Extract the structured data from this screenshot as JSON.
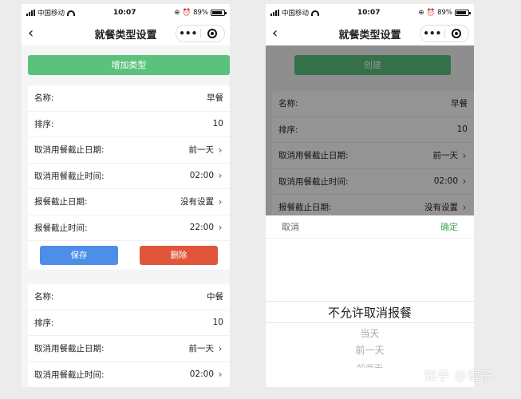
{
  "status_bar": {
    "carrier": "中国移动",
    "time": "10:07",
    "battery": "89%"
  },
  "navbar": {
    "title": "就餐类型设置",
    "more": "•••"
  },
  "left": {
    "add_button": "增加类型",
    "cards": [
      {
        "rows": [
          {
            "label": "名称:",
            "value": "早餐",
            "chevron": false
          },
          {
            "label": "排序:",
            "value": "10",
            "chevron": false
          },
          {
            "label": "取消用餐截止日期:",
            "value": "前一天",
            "chevron": true
          },
          {
            "label": "取消用餐截止时间:",
            "value": "02:00",
            "chevron": true
          },
          {
            "label": "报餐截止日期:",
            "value": "没有设置",
            "chevron": true
          },
          {
            "label": "报餐截止时间:",
            "value": "22:00",
            "chevron": true
          }
        ],
        "save_label": "保存",
        "delete_label": "删除"
      },
      {
        "rows": [
          {
            "label": "名称:",
            "value": "中餐",
            "chevron": false
          },
          {
            "label": "排序:",
            "value": "10",
            "chevron": false
          },
          {
            "label": "取消用餐截止日期:",
            "value": "前一天",
            "chevron": true
          },
          {
            "label": "取消用餐截止时间:",
            "value": "02:00",
            "chevron": true
          }
        ]
      }
    ]
  },
  "right": {
    "add_button": "创建",
    "card": {
      "rows": [
        {
          "label": "名称:",
          "value": "早餐",
          "chevron": false
        },
        {
          "label": "排序:",
          "value": "10",
          "chevron": false
        },
        {
          "label": "取消用餐截止日期:",
          "value": "前一天",
          "chevron": true
        },
        {
          "label": "取消用餐截止时间:",
          "value": "02:00",
          "chevron": true
        },
        {
          "label": "报餐截止日期:",
          "value": "没有设置",
          "chevron": true
        }
      ]
    },
    "picker": {
      "cancel": "取消",
      "confirm": "确定",
      "selected": "不允许取消报餐",
      "options": [
        "当天",
        "前一天",
        "前两天"
      ]
    }
  },
  "watermark": "知乎 @雷子",
  "colors": {
    "add_button": "#5bc27d",
    "save_button": "#4c8ee8",
    "delete_button": "#e0563a",
    "confirm_text": "#3cb34b"
  },
  "icons": {
    "back": "chevron-left-icon",
    "more": "more-dots-icon",
    "close": "target-circle-icon",
    "row_arrow": "chevron-right-icon"
  }
}
